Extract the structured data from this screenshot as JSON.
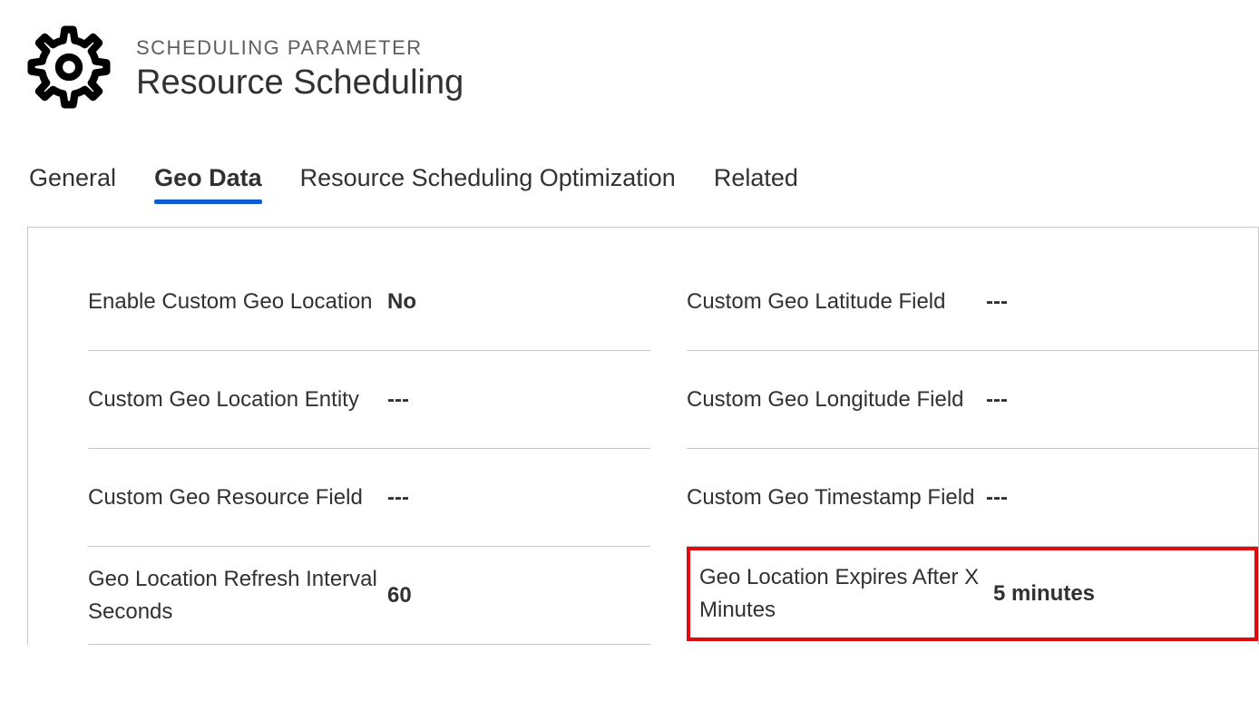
{
  "header": {
    "subtitle": "SCHEDULING PARAMETER",
    "title": "Resource Scheduling"
  },
  "tabs": {
    "general": "General",
    "geo_data": "Geo Data",
    "rso": "Resource Scheduling Optimization",
    "related": "Related"
  },
  "fields": {
    "left": {
      "enable_custom_geo_location": {
        "label": "Enable Custom Geo Location",
        "value": "No"
      },
      "custom_geo_location_entity": {
        "label": "Custom Geo Location Entity",
        "value": "---"
      },
      "custom_geo_resource_field": {
        "label": "Custom Geo Resource Field",
        "value": "---"
      },
      "geo_location_refresh_interval": {
        "label": "Geo Location Refresh Interval Seconds",
        "value": "60"
      }
    },
    "right": {
      "custom_geo_latitude_field": {
        "label": "Custom Geo Latitude Field",
        "value": "---"
      },
      "custom_geo_longitude_field": {
        "label": "Custom Geo Longitude Field",
        "value": "---"
      },
      "custom_geo_timestamp_field": {
        "label": "Custom Geo Timestamp Field",
        "value": "---"
      },
      "geo_location_expires": {
        "label": "Geo Location Expires After X Minutes",
        "value": "5 minutes"
      }
    }
  }
}
